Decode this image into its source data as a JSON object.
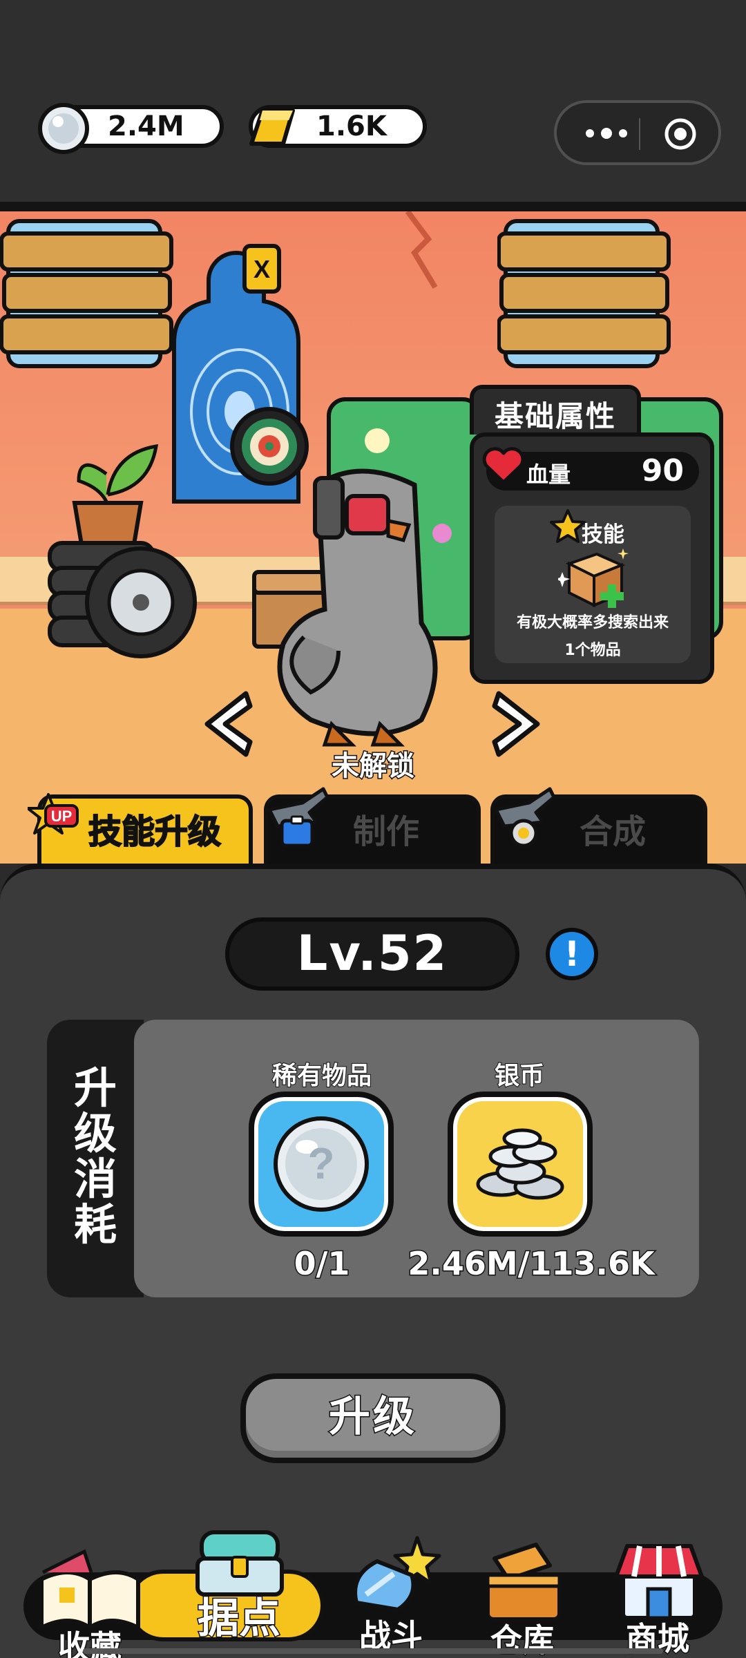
{
  "currency": {
    "silver": "2.4M",
    "gold": "1.6K"
  },
  "capsule": {
    "menu_icon": "more-dots-icon",
    "close_icon": "target-circle-icon"
  },
  "attributes": {
    "title": "基础属性",
    "hp_label": "血量",
    "hp_value": "90",
    "skill_label": "技能",
    "skill_desc_line1": "有极大概率多搜索出来",
    "skill_desc_line2": "1个物品"
  },
  "character": {
    "status": "未解锁"
  },
  "tabs": [
    {
      "label": "技能升级",
      "badge": "UP",
      "active": true
    },
    {
      "label": "制作",
      "active": false
    },
    {
      "label": "合成",
      "active": false
    }
  ],
  "upgrade": {
    "level": "Lv.52",
    "cost_label": "升级消耗",
    "cost_label_chars": [
      "升",
      "级",
      "消",
      "耗"
    ],
    "items": [
      {
        "title": "稀有物品",
        "count": "0/1",
        "icon": "mystery-orb-icon"
      },
      {
        "title": "银币",
        "count": "2.46M/113.6K",
        "icon": "silver-coins-icon"
      }
    ],
    "button_label": "升级"
  },
  "nav": [
    {
      "label": "收藏",
      "icon": "book-icon"
    },
    {
      "label": "据点",
      "icon": "chest-icon",
      "active": true
    },
    {
      "label": "战斗",
      "icon": "battle-icon"
    },
    {
      "label": "仓库",
      "icon": "storage-box-icon"
    },
    {
      "label": "商城",
      "icon": "shop-icon"
    }
  ],
  "colors": {
    "accent_yellow": "#f6c21c",
    "info_blue": "#1e88e5",
    "wall": "#f28564",
    "panel": "#3a3a3a"
  }
}
